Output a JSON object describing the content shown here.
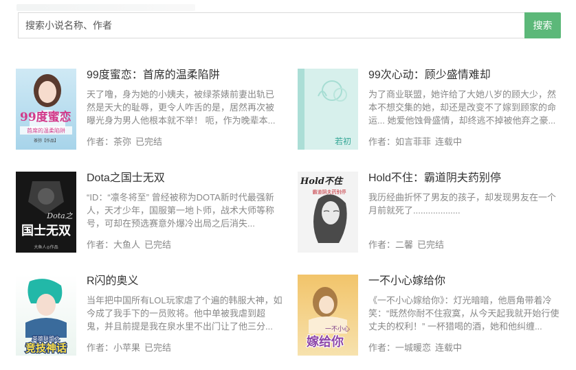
{
  "search": {
    "placeholder": "搜索小说名称、作者",
    "button_label": "搜索",
    "button_color": "#5cb879"
  },
  "books": [
    {
      "title": "99度蜜恋：首席的温柔陷阱",
      "desc": "天了噜，身为她的小姨夫，被绿茶婊前妻出轨已然是天大的耻辱，更令人咋舌的是，居然再次被曝光身为男人他根本就不举！ 呃，作为晚辈本...",
      "author": "作者：茶弥",
      "status": "已完结",
      "cover_text": "99度蜜恋",
      "cover_sub": "首席的温柔陷阱",
      "cover_author": "茶弥【作品】"
    },
    {
      "title": "99次心动：顾少盛情难却",
      "desc": "为了商业联盟，她许给了大她八岁的顾大少，然本不想交集的她，却还是改变不了嫁到顾家的命运... 她爱他蚀骨盛情，却终逃不掉被他弃之豪...",
      "author": "作者：如言菲菲",
      "status": "连载中",
      "cover_text": "若初"
    },
    {
      "title": "Dota之国士无双",
      "desc": "“ID：“凛冬将至” 曾经被称为DOTA新时代最强新人，天才少年，国服第一地卜师，战术大师等称号，可却在预选赛意外爆冷出局之后消失...",
      "author": "作者：大鱼人",
      "status": "已完结",
      "cover_text": "国士无双",
      "cover_top": "Dota之",
      "cover_author": "大鱼人◎作品"
    },
    {
      "title": "Hold不住：霸道阴夫药别停",
      "desc": "我历经曲折怀了男友的孩子，却发现男友在一个月前就死了...................",
      "author": "作者：二馨",
      "status": "已完结",
      "cover_text": "Hold不住",
      "cover_sub": "霸道阴夫药别停"
    },
    {
      "title": "R闪的奥义",
      "desc": "当年把中国所有LOL玩家虐了个遍的韩服大神，如今成了我手下的一员败将。他中单被我虐到超鬼，并且前提是我在泉水里不出门让了他三分...",
      "author": "作者：小苹果",
      "status": "已完结",
      "cover_top": "英雄联盟之",
      "cover_text": "竞技神话"
    },
    {
      "title": "一不小心嫁给你",
      "desc": "《一不小心嫁给你》：灯光暗暗，他唇角带着冷笑：“既然你耐不住寂寞，从今天起我就开始行使丈夫的权利！” 一杯猎喝的酒，她和他纠缠...",
      "author": "作者：一城暖恋",
      "status": "连载中",
      "cover_text": "嫁给你",
      "cover_top": "一不小心"
    }
  ]
}
